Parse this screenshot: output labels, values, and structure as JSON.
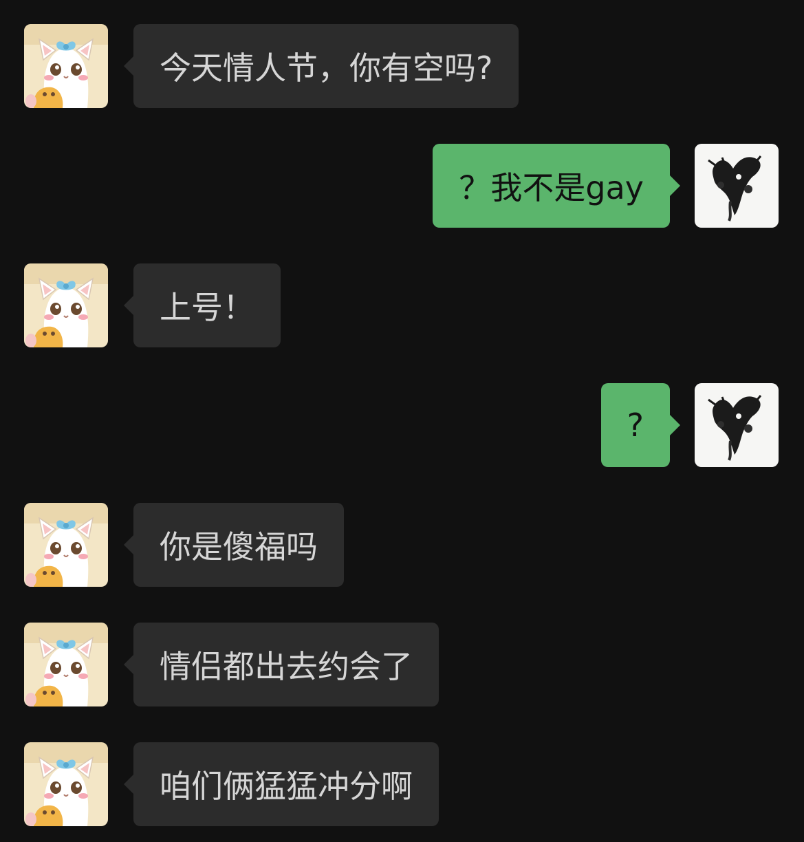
{
  "colors": {
    "background": "#111111",
    "incoming_bubble": "#2c2c2c",
    "incoming_text": "#d6d6d6",
    "outgoing_bubble": "#5bb56c",
    "outgoing_text": "#111111"
  },
  "contact": {
    "avatar_icon": "cartoon-cat-avatar-icon"
  },
  "self": {
    "avatar_icon": "ink-wash-avatar-icon"
  },
  "messages": [
    {
      "side": "incoming",
      "text": "今天情人节，你有空吗?"
    },
    {
      "side": "outgoing",
      "text": "？我不是gay"
    },
    {
      "side": "incoming",
      "text": "上号！"
    },
    {
      "side": "outgoing",
      "text": "?"
    },
    {
      "side": "incoming",
      "text": "你是傻福吗"
    },
    {
      "side": "incoming",
      "text": "情侣都出去约会了"
    },
    {
      "side": "incoming",
      "text": "咱们俩猛猛冲分啊"
    }
  ]
}
